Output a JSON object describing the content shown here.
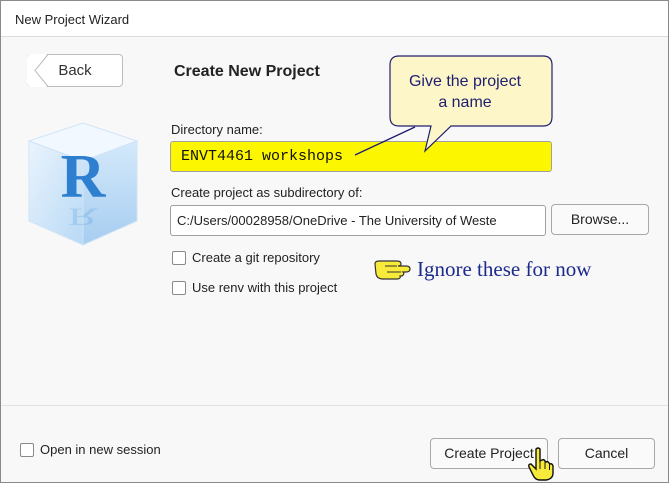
{
  "window": {
    "title": "New Project Wizard"
  },
  "header": {
    "back_label": "Back",
    "heading": "Create New Project"
  },
  "form": {
    "directory_label": "Directory name:",
    "directory_value": "ENVT4461 workshops",
    "parent_label": "Create project as subdirectory of:",
    "parent_value": "C:/Users/00028958/OneDrive - The University of Weste",
    "browse_label": "Browse...",
    "git_label": "Create a git repository",
    "renv_label": "Use renv with this project",
    "git_checked": false,
    "renv_checked": false
  },
  "annotations": {
    "callout_line1": "Give the project",
    "callout_line2": "a name",
    "ignore_text": "Ignore these for now",
    "callout_color": "#fdf6c8",
    "callout_border": "#1f1f70"
  },
  "footer": {
    "new_session_label": "Open in new session",
    "new_session_checked": false,
    "create_label": "Create Project",
    "cancel_label": "Cancel"
  },
  "icons": {
    "logo": "r-logo",
    "back": "back-arrow-icon",
    "pointer": "pointing-hand-icon",
    "cursor": "hand-cursor-icon"
  },
  "colors": {
    "highlight": "#fcf700",
    "annotation_text": "#1c2a8c"
  }
}
